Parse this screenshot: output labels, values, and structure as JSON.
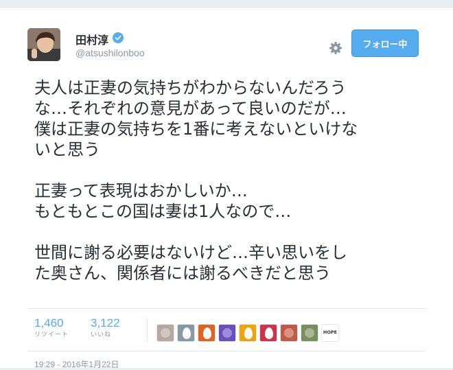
{
  "user": {
    "display_name": "田村淳",
    "handle": "@atsushilonboo",
    "verified": true
  },
  "follow_button": {
    "label": "フォロー中"
  },
  "tweet": {
    "paragraphs": [
      [
        "夫人は正妻の気持ちがわからないんだろう",
        "な…それぞれの意見があって良いのだが…",
        "僕は正妻の気持ちを1番に考えないといけな",
        "いと思う"
      ],
      [
        "正妻って表現はおかしいか…",
        "もともとこの国は妻は1人なので…"
      ],
      [
        "世間に謝る必要はないけど…辛い思いをし",
        "た奥さん、関係者には謝るべきだと思う"
      ]
    ]
  },
  "stats": {
    "retweets": {
      "count": "1,460",
      "label": "リツイート"
    },
    "likes": {
      "count": "3,122",
      "label": "いいね"
    }
  },
  "likers": [
    {
      "icon": "photo-avatar",
      "color": "#b8a9a0"
    },
    {
      "icon": "default-egg-avatar",
      "color": "#8899a6"
    },
    {
      "icon": "default-egg-avatar",
      "color": "#e0641d"
    },
    {
      "icon": "photo-avatar",
      "color": "#6a4fc0"
    },
    {
      "icon": "default-egg-avatar",
      "color": "#f0a30a"
    },
    {
      "icon": "default-egg-avatar",
      "color": "#d0324a"
    },
    {
      "icon": "photo-avatar",
      "color": "#c25b45"
    },
    {
      "icon": "photo-avatar",
      "color": "#7a8f5e"
    },
    {
      "icon": "hope-logo-avatar",
      "color": "#ffffff",
      "text": "HOPE"
    }
  ],
  "timestamp": "19:29 - 2016年1月22日",
  "colors": {
    "accent": "#55acee",
    "text": "#292f33",
    "muted": "#8899a6"
  }
}
